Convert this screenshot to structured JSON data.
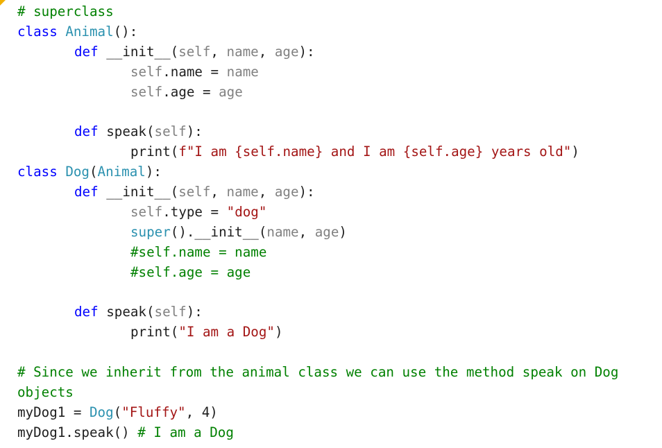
{
  "code": {
    "lines": [
      [
        {
          "t": "# superclass",
          "k": "comment"
        }
      ],
      [
        {
          "t": "class ",
          "k": "keyword"
        },
        {
          "t": "Animal",
          "k": "classname"
        },
        {
          "t": "():",
          "k": "plain"
        }
      ],
      [
        {
          "t": "def ",
          "k": "keyword"
        },
        {
          "t": "__init__(",
          "k": "plain"
        },
        {
          "t": "self",
          "k": "param"
        },
        {
          "t": ", ",
          "k": "plain"
        },
        {
          "t": "name",
          "k": "param"
        },
        {
          "t": ", ",
          "k": "plain"
        },
        {
          "t": "age",
          "k": "param"
        },
        {
          "t": "):",
          "k": "plain"
        }
      ],
      [
        {
          "t": "self",
          "k": "param"
        },
        {
          "t": ".name = ",
          "k": "plain"
        },
        {
          "t": "name",
          "k": "param"
        }
      ],
      [
        {
          "t": "self",
          "k": "param"
        },
        {
          "t": ".age = ",
          "k": "plain"
        },
        {
          "t": "age",
          "k": "param"
        }
      ],
      [],
      [
        {
          "t": "def ",
          "k": "keyword"
        },
        {
          "t": "speak(",
          "k": "plain"
        },
        {
          "t": "self",
          "k": "param"
        },
        {
          "t": "):",
          "k": "plain"
        }
      ],
      [
        {
          "t": "print(",
          "k": "plain"
        },
        {
          "t": "f\"I am {self.name} and I am {self.age} years old\"",
          "k": "string"
        },
        {
          "t": ")",
          "k": "plain"
        }
      ],
      [
        {
          "t": "class ",
          "k": "keyword"
        },
        {
          "t": "Dog",
          "k": "classname"
        },
        {
          "t": "(",
          "k": "plain"
        },
        {
          "t": "Animal",
          "k": "classname"
        },
        {
          "t": "):",
          "k": "plain"
        }
      ],
      [
        {
          "t": "def ",
          "k": "keyword"
        },
        {
          "t": "__init__(",
          "k": "plain"
        },
        {
          "t": "self",
          "k": "param"
        },
        {
          "t": ", ",
          "k": "plain"
        },
        {
          "t": "name",
          "k": "param"
        },
        {
          "t": ", ",
          "k": "plain"
        },
        {
          "t": "age",
          "k": "param"
        },
        {
          "t": "):",
          "k": "plain"
        }
      ],
      [
        {
          "t": "self",
          "k": "param"
        },
        {
          "t": ".type = ",
          "k": "plain"
        },
        {
          "t": "\"dog\"",
          "k": "string"
        }
      ],
      [
        {
          "t": "super",
          "k": "classname"
        },
        {
          "t": "().__init__(",
          "k": "plain"
        },
        {
          "t": "name",
          "k": "param"
        },
        {
          "t": ", ",
          "k": "plain"
        },
        {
          "t": "age",
          "k": "param"
        },
        {
          "t": ")",
          "k": "plain"
        }
      ],
      [
        {
          "t": "#self.name = name",
          "k": "comment"
        }
      ],
      [
        {
          "t": "#self.age = age",
          "k": "comment"
        }
      ],
      [],
      [
        {
          "t": "def ",
          "k": "keyword"
        },
        {
          "t": "speak(",
          "k": "plain"
        },
        {
          "t": "self",
          "k": "param"
        },
        {
          "t": "):",
          "k": "plain"
        }
      ],
      [
        {
          "t": "print(",
          "k": "plain"
        },
        {
          "t": "\"I am a Dog\"",
          "k": "string"
        },
        {
          "t": ")",
          "k": "plain"
        }
      ],
      [],
      [
        {
          "t": "# Since we inherit from the animal class we can use the method speak on Dog",
          "k": "comment"
        }
      ],
      [
        {
          "t": "objects",
          "k": "comment"
        }
      ],
      [
        {
          "t": "myDog1 = ",
          "k": "plain"
        },
        {
          "t": "Dog",
          "k": "classname"
        },
        {
          "t": "(",
          "k": "plain"
        },
        {
          "t": "\"Fluffy\"",
          "k": "string"
        },
        {
          "t": ", 4)",
          "k": "plain"
        }
      ],
      [
        {
          "t": "myDog1.speak() ",
          "k": "plain"
        },
        {
          "t": "# I am a Dog",
          "k": "comment"
        }
      ]
    ]
  },
  "colors": {
    "keyword": "#0000ff",
    "classname": "#2b91af",
    "param": "#808080",
    "string": "#a31515",
    "comment": "#008000",
    "plain": "#1e1e1e",
    "corner_marker": "#f0b000"
  }
}
